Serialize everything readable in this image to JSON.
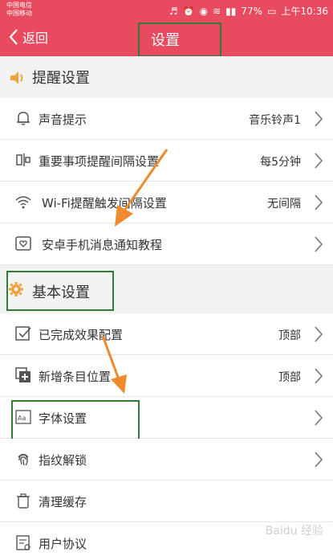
{
  "status": {
    "carrier1": "中国电信",
    "carrier2": "中国移动",
    "battery": "77%",
    "time": "上午10:36"
  },
  "nav": {
    "back_label": "返回",
    "title": "设置"
  },
  "sections": {
    "reminder": "提醒设置",
    "basic": "基本设置"
  },
  "rows": [
    {
      "label": "声音提示",
      "value": "音乐铃声1"
    },
    {
      "label": "重要事项提醒间隔设置",
      "value": "每5分钟"
    },
    {
      "label": "Wi-Fi提醒触发间隔设置",
      "value": "无间隔"
    },
    {
      "label": "安卓手机消息通知教程",
      "value": ""
    },
    {
      "label": "已完成效果配置",
      "value": "顶部"
    },
    {
      "label": "新增条目位置",
      "value": "顶部"
    },
    {
      "label": "字体设置",
      "value": ""
    },
    {
      "label": "指纹解锁",
      "value": ""
    },
    {
      "label": "清理缓存",
      "value": ""
    },
    {
      "label": "用户协议",
      "value": ""
    }
  ],
  "colors": {
    "header": "#e84a5f",
    "section_icon": "#f0a23a",
    "highlight": "#2e7d32",
    "arrow": "#f08a2e"
  },
  "watermark": "Baidu 经验"
}
